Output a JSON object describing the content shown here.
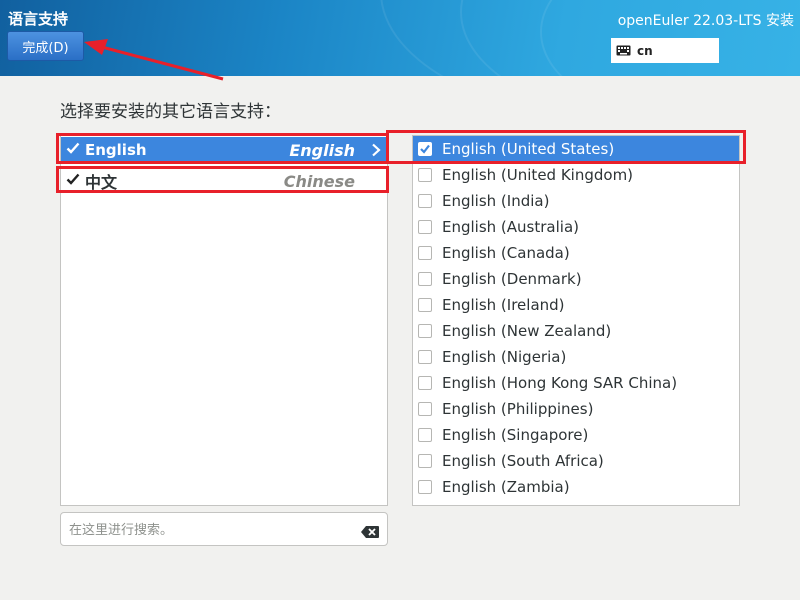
{
  "header": {
    "spoke_title": "语言支持",
    "done_label": "完成(D)",
    "product_title": "openEuler 22.03-LTS 安装",
    "keyboard_layout": "cn",
    "keyboard_icon": "keyboard-icon"
  },
  "prompt": "选择要安装的其它语言支持：",
  "languages": [
    {
      "native": "English",
      "english": "English",
      "checked": true,
      "selected": true
    },
    {
      "native": "中文",
      "english": "Chinese",
      "checked": true,
      "selected": false
    }
  ],
  "locales": [
    {
      "label": "English (United States)",
      "checked": true,
      "selected": true
    },
    {
      "label": "English (United Kingdom)",
      "checked": false
    },
    {
      "label": "English (India)",
      "checked": false
    },
    {
      "label": "English (Australia)",
      "checked": false
    },
    {
      "label": "English (Canada)",
      "checked": false
    },
    {
      "label": "English (Denmark)",
      "checked": false
    },
    {
      "label": "English (Ireland)",
      "checked": false
    },
    {
      "label": "English (New Zealand)",
      "checked": false
    },
    {
      "label": "English (Nigeria)",
      "checked": false
    },
    {
      "label": "English (Hong Kong SAR China)",
      "checked": false
    },
    {
      "label": "English (Philippines)",
      "checked": false
    },
    {
      "label": "English (Singapore)",
      "checked": false
    },
    {
      "label": "English (South Africa)",
      "checked": false
    },
    {
      "label": "English (Zambia)",
      "checked": false
    }
  ],
  "search": {
    "placeholder": "在这里进行搜索。",
    "value": ""
  },
  "colors": {
    "selection": "#3c86de",
    "annotation": "#e8202a",
    "header_start": "#11609f",
    "header_end": "#37b2e6"
  }
}
